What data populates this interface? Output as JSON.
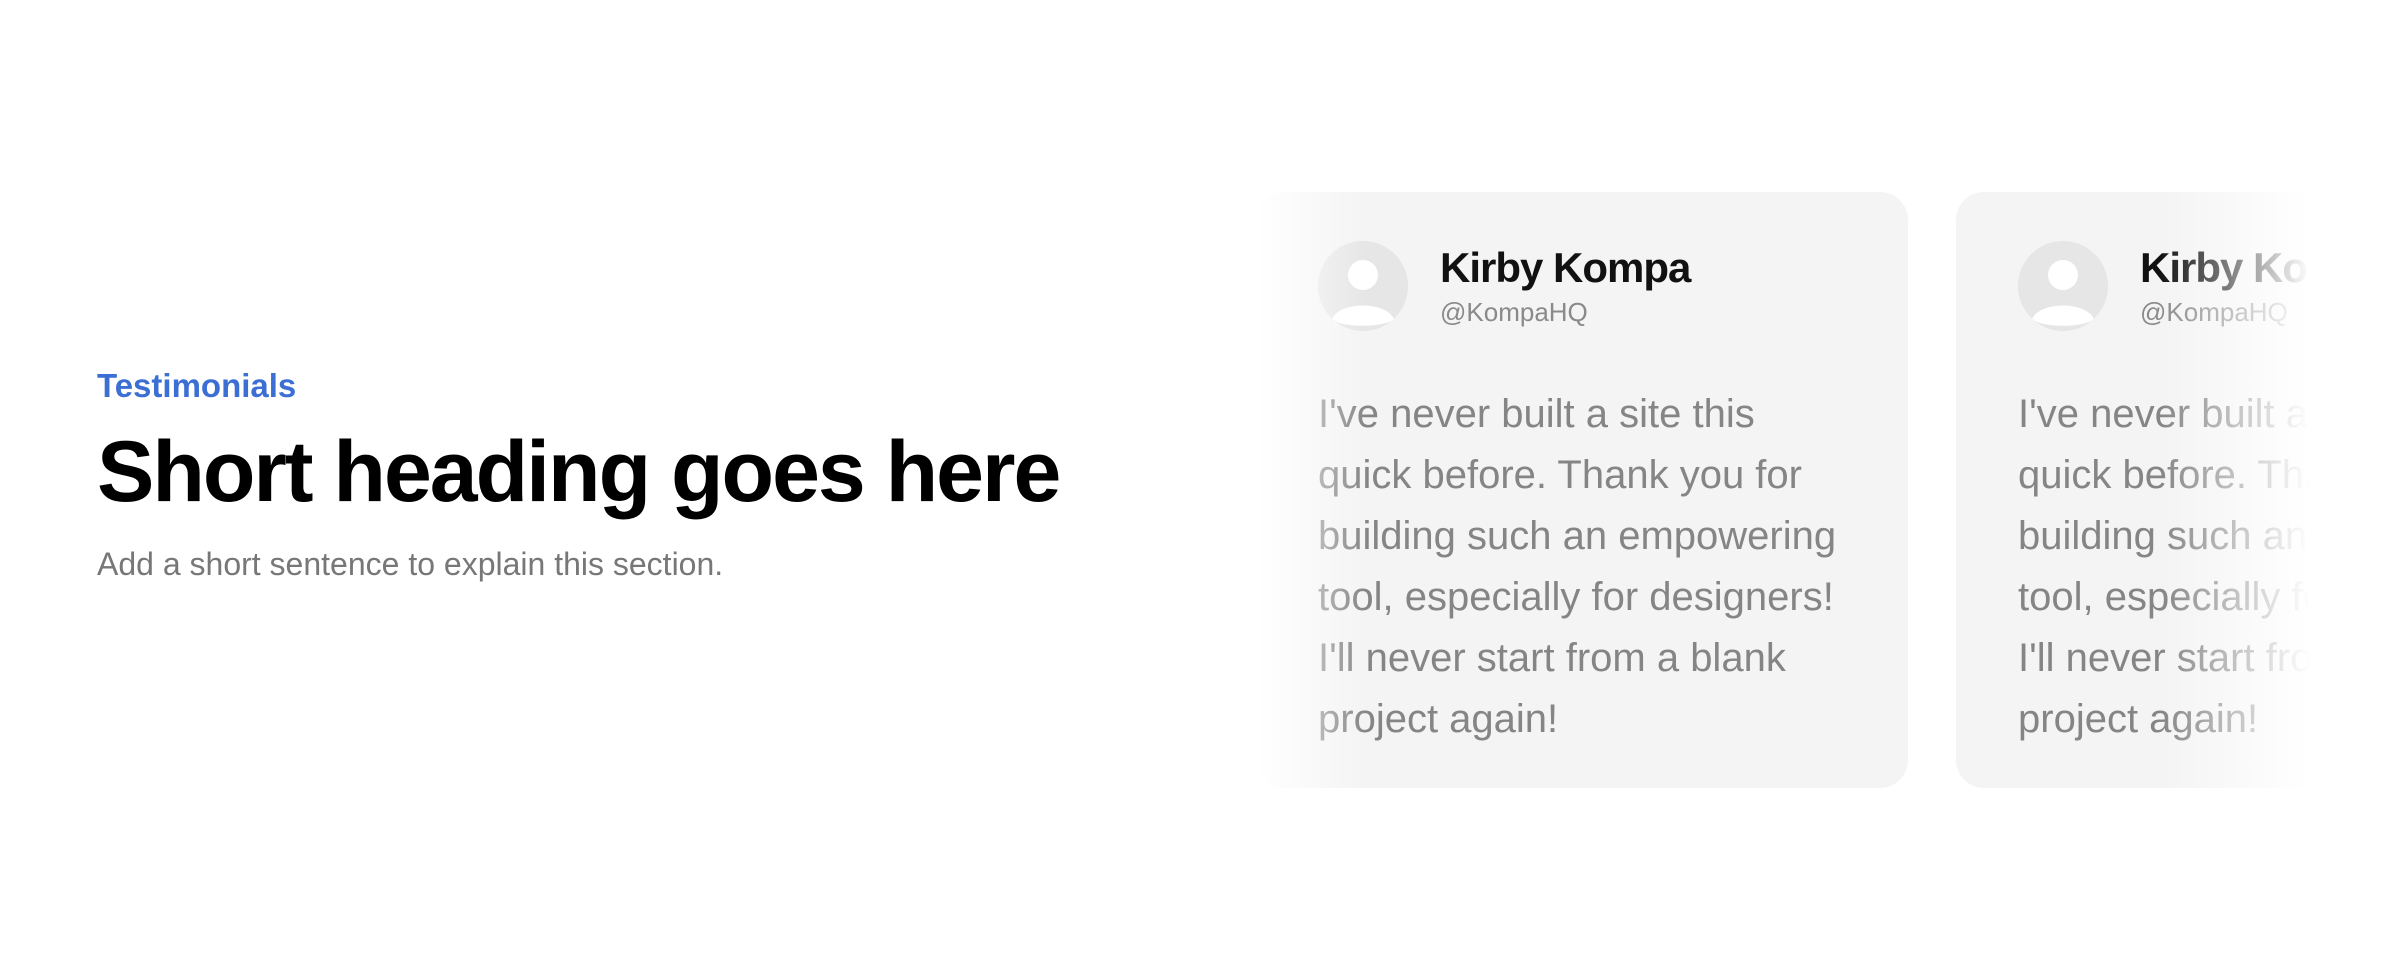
{
  "section": {
    "eyebrow": "Testimonials",
    "heading": "Short heading goes here",
    "subtitle": "Add a short sentence to explain this section."
  },
  "testimonials": [
    {
      "name": "Kirby Kompa",
      "handle": "@KompaHQ",
      "quote": "I've never built a site this quick before. Thank you for building such an empowering tool, especially for designers! I'll never start from a blank project again!",
      "avatar_icon": "user-avatar-icon"
    },
    {
      "name": "Kirby Kompa",
      "handle": "@KompaHQ",
      "quote": "I've never built a site this quick before. Thank you for building such an empowering tool, especially for designers! I'll never start from a blank project again!",
      "avatar_icon": "user-avatar-icon"
    }
  ],
  "colors": {
    "accent": "#3b6fd4",
    "card_background": "#f4f4f4",
    "heading": "#000000",
    "muted_text": "#777777"
  }
}
